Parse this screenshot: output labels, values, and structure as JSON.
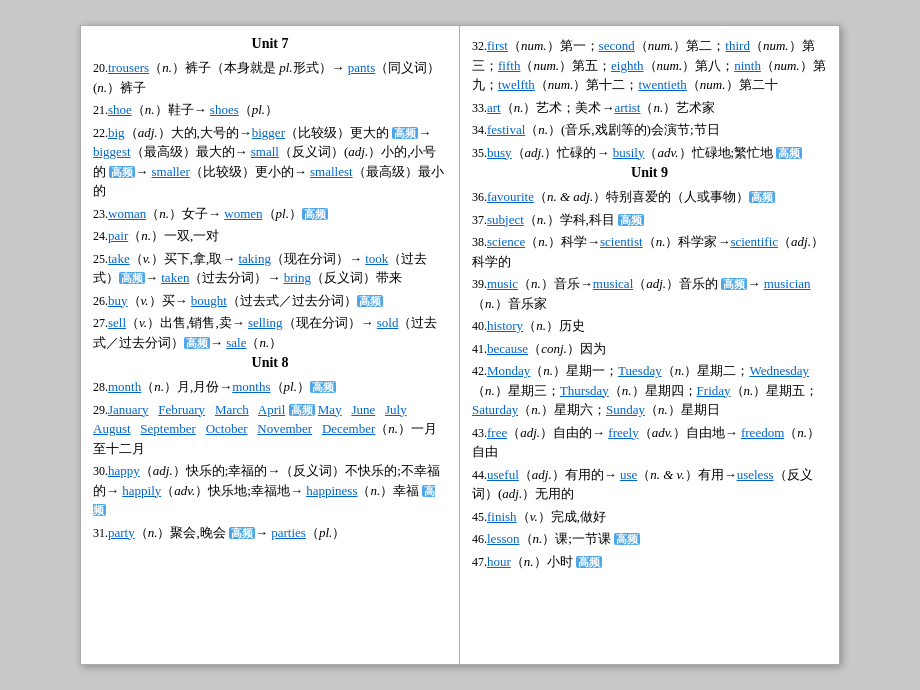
{
  "left": {
    "unit7_title": "Unit 7",
    "entries_unit7": [
      {
        "num": "20.",
        "content": "<span class='blue-link'>trousers</span>（<em>n.</em>）裤子（本身就是 <em>pl.</em>形式）→ <span class='blue-link'>pants</span>（同义词）(<em>n.</em>）裤子"
      },
      {
        "num": "21.",
        "content": "<span class='blue-link'>shoe</span>（<em>n.</em>）鞋子→ <span class='blue-link'>shoes</span>（<em>pl.</em>）"
      },
      {
        "num": "22.",
        "content": "<span class='blue-link'>big</span>（<em>adj.</em>）大的,大号的→<span class='blue-link'>bigger</span>（比较级）更大的 <span class='highlight-blue'>高频</span>→ <span class='blue-link'>biggest</span>（最高级）最大的→ <span class='blue-link'>small</span>（反义词）(<em>adj.</em>）小的,小号的 <span class='highlight-blue'>高频</span>→ <span class='blue-link'>smaller</span>（比较级）更小的→ <span class='blue-link'>smallest</span>（最高级）最小的"
      },
      {
        "num": "23.",
        "content": "<span class='blue-link'>woman</span>（<em>n.</em>）女子→ <span class='blue-link'>women</span>（<em>pl.</em>）<span class='highlight-blue'>高频</span>"
      },
      {
        "num": "24.",
        "content": "<span class='blue-link'>pair</span>（<em>n.</em>）一双,一对"
      },
      {
        "num": "25.",
        "content": "<span class='blue-link'>take</span>（<em>v.</em>）买下,拿,取→ <span class='blue-link'>taking</span>（现在分词）→ <span class='blue-link'>took</span>（过去式）<span class='highlight-blue'>高频</span>→ <span class='blue-link'>taken</span>（过去分词）→ <span class='blue-link'>bring</span>（反义词）带来"
      },
      {
        "num": "26.",
        "content": "<span class='blue-link'>buy</span>（<em>v.</em>）买→ <span class='blue-link'>bought</span>（过去式／过去分词）<span class='highlight-blue'>高频</span>"
      },
      {
        "num": "27.",
        "content": "<span class='blue-link'>sell</span>（<em>v.</em>）出售,销售,卖→ <span class='blue-link'>selling</span>（现在分词）→ <span class='blue-link'>sold</span>（过去式／过去分词）<span class='highlight-blue'>高频</span>→ <span class='blue-link'>sale</span>（<em>n.</em>）"
      }
    ],
    "unit8_title": "Unit 8",
    "entries_unit8": [
      {
        "num": "28.",
        "content": "<span class='blue-link'>month</span>（<em>n.</em>）月,月份→<span class='blue-link'>months</span>（<em>pl.</em>）<span class='highlight-blue'>高频</span>"
      },
      {
        "num": "29.",
        "content": "<span class='blue-link'>January</span> &nbsp; <span class='blue-link'>February</span> &nbsp; <span class='blue-link'>March</span> &nbsp; <span class='blue-link'>April</span> <span class='highlight-blue'>高频</span> <span class='blue-link'>May</span> &nbsp; <span class='blue-link'>June</span> &nbsp; <span class='blue-link'>July</span> &nbsp; <span class='blue-link'>August</span> &nbsp; <span class='blue-link'>September</span> &nbsp; <span class='blue-link'>October</span> &nbsp; <span class='blue-link'>November</span> &nbsp; <span class='blue-link'>December</span>（<em>n.</em>）一月至十二月"
      },
      {
        "num": "30.",
        "content": "<span class='blue-link'>happy</span>（<em>adj.</em>）快乐的;幸福的→（反义词）不快乐的;不幸福的→ <span class='blue-link'>happily</span>（<em>adv.</em>）快乐地;幸福地→ <span class='blue-link'>happiness</span>（<em>n.</em>）幸福 <span class='highlight-blue'>高频</span>"
      },
      {
        "num": "31.",
        "content": "<span class='blue-link'>party</span>（<em>n.</em>）聚会,晚会 <span class='highlight-blue'>高频</span>→ <span class='blue-link'>parties</span>（<em>pl.</em>）"
      }
    ]
  },
  "right": {
    "entries_32plus": [
      {
        "num": "32.",
        "content": "<span class='blue-link'>first</span>（<em>num.</em>）第一；<span class='blue-link'>second</span>（<em>num.</em>）第二；<span class='blue-link'>third</span>（<em>num.</em>）第三；<span class='blue-link'>fifth</span>（<em>num.</em>）第五；<span class='blue-link'>eighth</span>（<em>num.</em>）第八；<span class='blue-link'>ninth</span>（<em>num.</em>）第九；<span class='blue-link'>twelfth</span>（<em>num.</em>）第十二；<span class='blue-link'>twentieth</span>（<em>num.</em>）第二十"
      },
      {
        "num": "33.",
        "content": "<span class='blue-link'>art</span>（<em>n.</em>）艺术；美术→<span class='blue-link'>artist</span>（<em>n.</em>）艺术家"
      },
      {
        "num": "34.",
        "content": "<span class='blue-link'>festival</span>（<em>n.</em>）(音乐,戏剧等的)会演节;节日"
      },
      {
        "num": "35.",
        "content": "<span class='blue-link'>busy</span>（<em>adj.</em>）忙碌的→ <span class='blue-link'>busily</span>（<em>adv.</em>）忙碌地;繁忙地 <span class='highlight-blue'>高频</span>"
      }
    ],
    "unit9_title": "Unit 9",
    "entries_unit9": [
      {
        "num": "36.",
        "content": "<span class='blue-link'>favourite</span>（<em>n. &amp; adj.</em>）特别喜爱的（人或事物）<span class='highlight-blue'>高频</span>"
      },
      {
        "num": "37.",
        "content": "<span class='blue-link'>subject</span>（<em>n.</em>）学科,科目 <span class='highlight-blue'>高频</span>"
      },
      {
        "num": "38.",
        "content": "<span class='blue-link'>science</span>（<em>n.</em>）科学→<span class='blue-link'>scientist</span>（<em>n.</em>）科学家→<span class='blue-link'>scientific</span>（<em>adj.</em>）科学的"
      },
      {
        "num": "39.",
        "content": "<span class='blue-link'>music</span>（<em>n.</em>）音乐→<span class='blue-link'>musical</span>（<em>adj.</em>）音乐的 <span class='highlight-blue'>高频</span>→ <span class='blue-link'>musician</span>（<em>n.</em>）音乐家"
      },
      {
        "num": "40.",
        "content": "<span class='blue-link'>history</span>（<em>n.</em>）历史"
      },
      {
        "num": "41.",
        "content": "<span class='blue-link'>because</span>（<em>conj.</em>）因为"
      },
      {
        "num": "42.",
        "content": "<span class='blue-link'>Monday</span>（<em>n.</em>）星期一；<span class='blue-link'>Tuesday</span>（<em>n.</em>）星期二；<span class='blue-link'>Wednesday</span>（<em>n.</em>）星期三；<span class='blue-link'>Thursday</span>（<em>n.</em>）星期四；<span class='blue-link'>Friday</span>（<em>n.</em>）星期五；<span class='blue-link'>Saturday</span>（<em>n.</em>）星期六；<span class='blue-link'>Sunday</span>（<em>n.</em>）星期日"
      },
      {
        "num": "43.",
        "content": "<span class='blue-link'>free</span>（<em>adj.</em>）自由的→ <span class='blue-link'>freely</span>（<em>adv.</em>）自由地→ <span class='blue-link'>freedom</span>（<em>n.</em>）自由"
      },
      {
        "num": "44.",
        "content": "<span class='blue-link'>useful</span>（<em>adj.</em>）有用的→ <span class='blue-link'>use</span>（<em>n. &amp; v.</em>）有用→<span class='blue-link'>useless</span>（反义词）(<em>adj.</em>）无用的"
      },
      {
        "num": "45.",
        "content": "<span class='blue-link'>finish</span>（<em>v.</em>）完成,做好"
      },
      {
        "num": "46.",
        "content": "<span class='blue-link'>lesson</span>（<em>n.</em>）课;一节课 <span class='highlight-blue'>高频</span>"
      },
      {
        "num": "47.",
        "content": "<span class='blue-link'>hour</span>（<em>n.</em>）小时 <span class='highlight-blue'>高频</span>"
      }
    ]
  }
}
